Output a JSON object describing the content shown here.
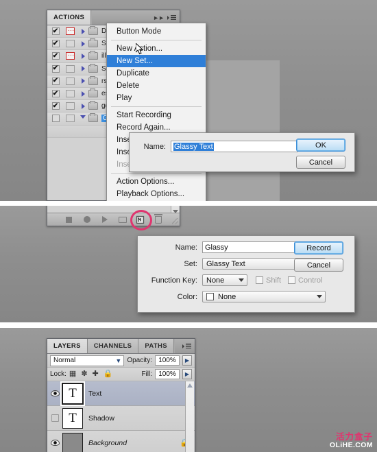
{
  "meta": {
    "watermark_cn": "活力盒子",
    "watermark_en": "OLiHE.COM"
  },
  "shot1": {
    "panel": {
      "tabs": [
        {
          "label": "ACTIONS",
          "active": true
        }
      ],
      "collapse_icon": "double-arrow-right-icon",
      "menu_icon": "panel-menu-icon"
    },
    "action_rows": [
      {
        "check": "✔",
        "dialog_toggle": true,
        "name": "De",
        "expanded": false,
        "selected": false
      },
      {
        "check": "✔",
        "dialog_toggle": false,
        "name": "Se",
        "expanded": false,
        "selected": false
      },
      {
        "check": "✔",
        "dialog_toggle": true,
        "name": "illu",
        "expanded": false,
        "selected": false
      },
      {
        "check": "✔",
        "dialog_toggle": false,
        "name": "Sh",
        "expanded": false,
        "selected": false
      },
      {
        "check": "✔",
        "dialog_toggle": false,
        "name": "rss",
        "expanded": false,
        "selected": false
      },
      {
        "check": "✔",
        "dialog_toggle": false,
        "name": "es",
        "expanded": false,
        "selected": false
      },
      {
        "check": "✔",
        "dialog_toggle": false,
        "name": "go",
        "expanded": false,
        "selected": false
      },
      {
        "check": "",
        "dialog_toggle": false,
        "name": "Gl",
        "expanded": true,
        "selected": true
      }
    ],
    "context_menu": [
      {
        "label": "Button Mode",
        "state": "normal"
      },
      {
        "label": "__sep__",
        "state": "sep"
      },
      {
        "label": "New Action...",
        "state": "normal"
      },
      {
        "label": "New Set...",
        "state": "highlighted"
      },
      {
        "label": "Duplicate",
        "state": "normal"
      },
      {
        "label": "Delete",
        "state": "normal"
      },
      {
        "label": "Play",
        "state": "normal"
      },
      {
        "label": "__sep__",
        "state": "sep"
      },
      {
        "label": "Start Recording",
        "state": "normal"
      },
      {
        "label": "Record Again...",
        "state": "normal"
      },
      {
        "label": "Insert Menu Item...",
        "state": "normal"
      },
      {
        "label": "Insert Stop...",
        "state": "normal"
      },
      {
        "label": "Insert Path",
        "state": "disabled"
      },
      {
        "label": "__sep__",
        "state": "sep"
      },
      {
        "label": "Action Options...",
        "state": "normal"
      },
      {
        "label": "Playback Options...",
        "state": "normal"
      }
    ],
    "new_set_dialog": {
      "name_label": "Name:",
      "name_value": "Glassy Text",
      "name_selected": true,
      "ok_label": "OK",
      "cancel_label": "Cancel"
    },
    "cursor": "arrow-cursor"
  },
  "shot2": {
    "toolbar_icons": [
      "stop-icon",
      "record-icon",
      "play-icon",
      "new-set-folder-icon",
      "new-action-icon",
      "delete-trash-icon"
    ],
    "highlight_annotation": "pink-circle-highlight",
    "new_action_dialog": {
      "fields": [
        {
          "label": "Name:",
          "type": "text",
          "value": "Glassy"
        },
        {
          "label": "Set:",
          "type": "select",
          "value": "Glassy Text"
        },
        {
          "label": "Function Key:",
          "type": "select",
          "value": "None"
        },
        {
          "label": "Color:",
          "type": "select",
          "value": "None"
        }
      ],
      "shift_label": "Shift",
      "shift_checked": false,
      "control_label": "Control",
      "control_checked": false,
      "record_label": "Record",
      "cancel_label": "Cancel"
    }
  },
  "shot3": {
    "panel": {
      "tabs": [
        {
          "label": "LAYERS",
          "active": true
        },
        {
          "label": "CHANNELS",
          "active": false
        },
        {
          "label": "PATHS",
          "active": false
        }
      ],
      "menu_icon": "panel-menu-icon"
    },
    "blend_mode": "Normal",
    "opacity_label": "Opacity:",
    "opacity_value": "100%",
    "lock_label": "Lock:",
    "lock_icons": [
      "lock-transparent-pixels-icon",
      "lock-image-pixels-icon",
      "lock-position-icon",
      "lock-all-icon"
    ],
    "fill_label": "Fill:",
    "fill_value": "100%",
    "layers": [
      {
        "name": "Text",
        "visible": true,
        "selected": true,
        "thumb": "T",
        "thumb_type": "text",
        "locked": false,
        "italic": false
      },
      {
        "name": "Shadow",
        "visible": false,
        "selected": false,
        "thumb": "T",
        "thumb_type": "text",
        "locked": false,
        "italic": false
      },
      {
        "name": "Background",
        "visible": true,
        "selected": false,
        "thumb": "",
        "thumb_type": "solid",
        "locked": true,
        "italic": true
      }
    ]
  }
}
